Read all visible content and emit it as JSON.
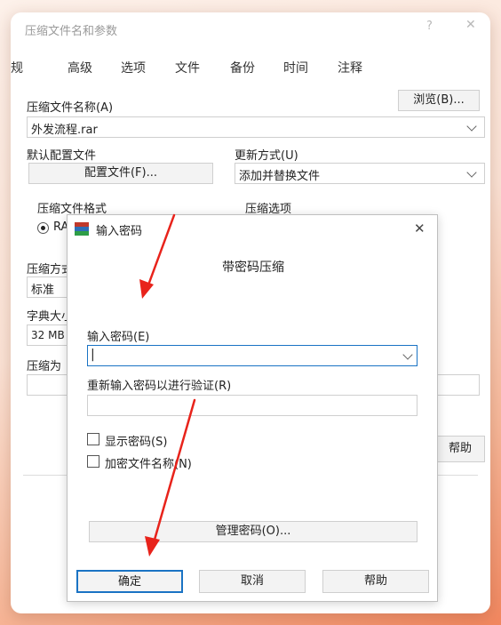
{
  "parent": {
    "title": "压缩文件名和参数",
    "help_glyph": "?",
    "close_glyph": "✕",
    "tabs": [
      "常规",
      "高级",
      "选项",
      "文件",
      "备份",
      "时间",
      "注释"
    ],
    "archive_name_label": "压缩文件名称(A)",
    "browse_button": "浏览(B)...",
    "archive_name_value": "外发流程.rar",
    "default_profile_label": "默认配置文件",
    "profile_button": "配置文件(F)...",
    "update_mode_label": "更新方式(U)",
    "update_mode_value": "添加并替换文件",
    "format_label": "压缩文件格式",
    "format_option": "RAR",
    "options_label": "压缩选项",
    "method_label": "压缩方式",
    "method_value": "标准",
    "dict_label": "字典大小",
    "dict_value": "32 MB",
    "split_label": "压缩为",
    "help_button": "帮助"
  },
  "modal": {
    "title": "输入密码",
    "close_glyph": "✕",
    "heading": "带密码压缩",
    "password_label": "输入密码(E)",
    "password_value": "|",
    "reenter_label": "重新输入密码以进行验证(R)",
    "show_password": "显示密码(S)",
    "encrypt_names": "加密文件名称(N)",
    "manage_button": "管理密码(O)...",
    "ok_button": "确定",
    "cancel_button": "取消",
    "help_button": "帮助"
  },
  "colors": {
    "accent": "#1a73c4",
    "arrow": "#e8231b",
    "icon_red": "#c0392b",
    "icon_blue": "#2e6fb7",
    "icon_green": "#2e9e47"
  }
}
